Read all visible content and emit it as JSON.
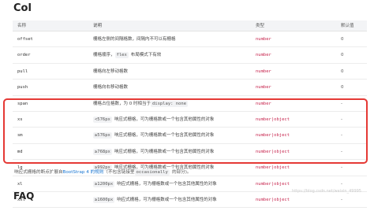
{
  "page": {
    "title": "Col",
    "faq_title": "FAQ",
    "watermark": "https://blog.csdn.net/weixin_49995"
  },
  "table": {
    "headers": {
      "param": "名称",
      "desc": "说明",
      "type": "类型",
      "default": "默认值"
    },
    "rows": [
      {
        "param": "offset",
        "desc": "栅格左侧的间隔格数，间隔内不可以有栅格",
        "code": "",
        "desc_after": "",
        "type": "number",
        "default": "0"
      },
      {
        "param": "order",
        "desc": "栅格顺序，",
        "code": "flex",
        "desc_after": "布局模式下有效",
        "type": "number",
        "default": "0"
      },
      {
        "param": "pull",
        "desc": "栅格向左移动格数",
        "code": "",
        "desc_after": "",
        "type": "number",
        "default": "0"
      },
      {
        "param": "push",
        "desc": "栅格向右移动格数",
        "code": "",
        "desc_after": "",
        "type": "number",
        "default": "0"
      },
      {
        "param": "span",
        "desc": "栅格占位格数，为 0 时相当于",
        "code": "display: none",
        "desc_after": "",
        "type": "number",
        "default": "-"
      },
      {
        "param": "xs",
        "desc": "",
        "code": "<576px",
        "desc_after": "响应式栅格，可为栅格数或一个包含其他属性的对象",
        "type": "number|object",
        "default": "-"
      },
      {
        "param": "sm",
        "desc": "",
        "code": "≥576px",
        "desc_after": "响应式栅格，可为栅格数或一个包含其他属性的对象",
        "type": "number|object",
        "default": "-"
      },
      {
        "param": "md",
        "desc": "",
        "code": "≥768px",
        "desc_after": "响应式栅格，可为栅格数或一个包含其他属性的对象",
        "type": "number|object",
        "default": "-"
      },
      {
        "param": "lg",
        "desc": "",
        "code": "≥992px",
        "desc_after": "响应式栅格，可为栅格数或一个包含其他属性的对象",
        "type": "number|object",
        "default": "-"
      },
      {
        "param": "xl",
        "desc": "",
        "code": "≥1200px",
        "desc_after": "响应式栅格，可为栅格数或一个包含其他属性的对象",
        "type": "number|object",
        "default": "-"
      },
      {
        "param": "xxl",
        "desc": "",
        "code": "≥1600px",
        "desc_after": "响应式栅格，可为栅格数或一个包含其他属性的对象",
        "type": "number|object",
        "default": "-"
      }
    ]
  },
  "footnote": {
    "prefix": "响应式栅格的断点扩展自",
    "link": "BootStrap 4 的规则",
    "middle": "（不包含链接里",
    "code": "occasionally",
    "suffix": "的部分)。"
  },
  "colors": {
    "highlight": "#e53935",
    "type": "#c7254e",
    "link": "#1976d2"
  }
}
